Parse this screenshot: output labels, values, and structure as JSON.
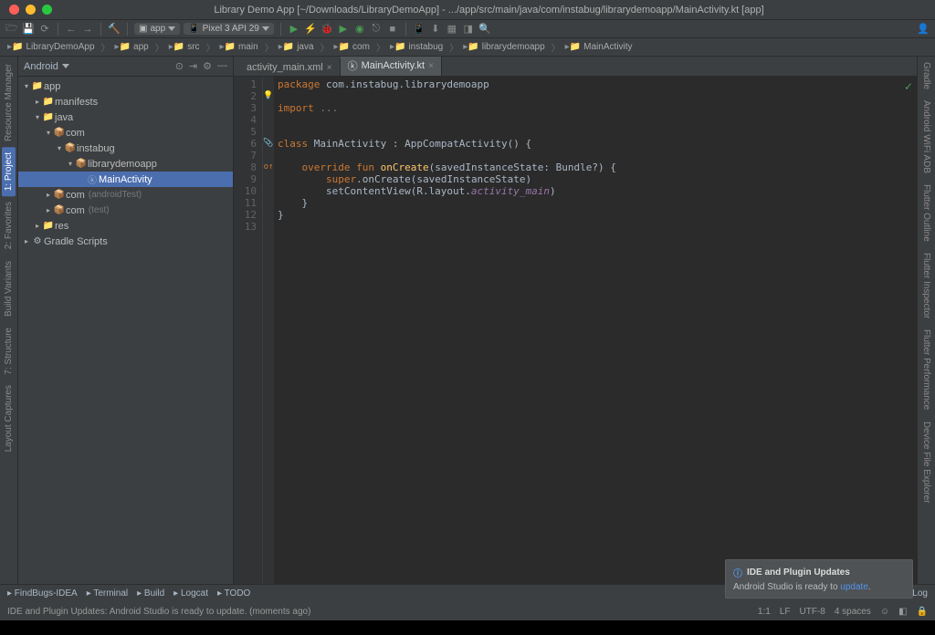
{
  "window": {
    "title": "Library Demo App [~/Downloads/LibraryDemoApp] - .../app/src/main/java/com/instabug/librarydemoapp/MainActivity.kt [app]"
  },
  "toolbar": {
    "config": "app",
    "device": "Pixel 3 API 29"
  },
  "breadcrumb": [
    "LibraryDemoApp",
    "app",
    "src",
    "main",
    "java",
    "com",
    "instabug",
    "librarydemoapp",
    "MainActivity"
  ],
  "project_view": {
    "mode": "Android"
  },
  "tree": [
    {
      "d": 0,
      "a": "▾",
      "i": "📁",
      "l": "app"
    },
    {
      "d": 1,
      "a": "▸",
      "i": "📁",
      "l": "manifests"
    },
    {
      "d": 1,
      "a": "▾",
      "i": "📁",
      "l": "java"
    },
    {
      "d": 2,
      "a": "▾",
      "i": "📦",
      "l": "com"
    },
    {
      "d": 3,
      "a": "▾",
      "i": "📦",
      "l": "instabug"
    },
    {
      "d": 4,
      "a": "▾",
      "i": "📦",
      "l": "librarydemoapp"
    },
    {
      "d": 5,
      "a": "",
      "i": "ⓚ",
      "l": "MainActivity",
      "sel": true
    },
    {
      "d": 2,
      "a": "▸",
      "i": "📦",
      "l": "com",
      "suf": "(androidTest)"
    },
    {
      "d": 2,
      "a": "▸",
      "i": "📦",
      "l": "com",
      "suf": "(test)"
    },
    {
      "d": 1,
      "a": "▸",
      "i": "📁",
      "l": "res"
    },
    {
      "d": 0,
      "a": "▸",
      "i": "⚙",
      "l": "Gradle Scripts"
    }
  ],
  "tabs": [
    {
      "icon": "</>",
      "label": "activity_main.xml",
      "active": false
    },
    {
      "icon": "ⓚ",
      "label": "MainActivity.kt",
      "active": true
    }
  ],
  "code": {
    "lines": [
      {
        "n": 1,
        "mk": "",
        "html": "<span class='kw'>package</span> <span class='pkg'>com.instabug.librarydemoapp</span>"
      },
      {
        "n": 2,
        "mk": "💡",
        "html": ""
      },
      {
        "n": 3,
        "mk": "",
        "html": "<span class='kw'>import</span> <span class='com'>...</span>"
      },
      {
        "n": 4,
        "mk": "",
        "html": ""
      },
      {
        "n": 5,
        "mk": "",
        "html": ""
      },
      {
        "n": 6,
        "mk": "📎",
        "html": "<span class='kw'>class</span> MainActivity : AppCompatActivity() {"
      },
      {
        "n": 7,
        "mk": "",
        "html": ""
      },
      {
        "n": 8,
        "mk": "o↑",
        "html": "    <span class='kw'>override fun</span> <span class='fn'>onCreate</span>(savedInstanceState: Bundle?) {"
      },
      {
        "n": 9,
        "mk": "",
        "html": "        <span class='kw'>super</span>.onCreate(savedInstanceState)"
      },
      {
        "n": 10,
        "mk": "",
        "html": "        setContentView(R.layout.<span class='ital'>activity_main</span>)"
      },
      {
        "n": 11,
        "mk": "",
        "html": "    }"
      },
      {
        "n": 12,
        "mk": "",
        "html": "}"
      },
      {
        "n": 13,
        "mk": "",
        "html": ""
      }
    ]
  },
  "notification": {
    "title": "IDE and Plugin Updates",
    "body_pre": "Android Studio is ready to ",
    "link": "update",
    "body_post": "."
  },
  "bottom_tools": [
    "FindBugs-IDEA",
    "Terminal",
    "Build",
    "Logcat",
    "TODO"
  ],
  "status": {
    "msg": "IDE and Plugin Updates: Android Studio is ready to update. (moments ago)",
    "pos": "1:1",
    "enc": "LF",
    "charset": "UTF-8",
    "indent": "4 spaces",
    "event_log": "Event Log"
  },
  "left_tools": [
    "Resource Manager",
    "1: Project",
    "2: Favorites",
    "Build Variants",
    "7: Structure",
    "Layout Captures"
  ],
  "right_tools": [
    "Gradle",
    "Android WiFi ADB",
    "Flutter Outline",
    "Flutter Inspector",
    "Flutter Performance",
    "Device File Explorer"
  ]
}
